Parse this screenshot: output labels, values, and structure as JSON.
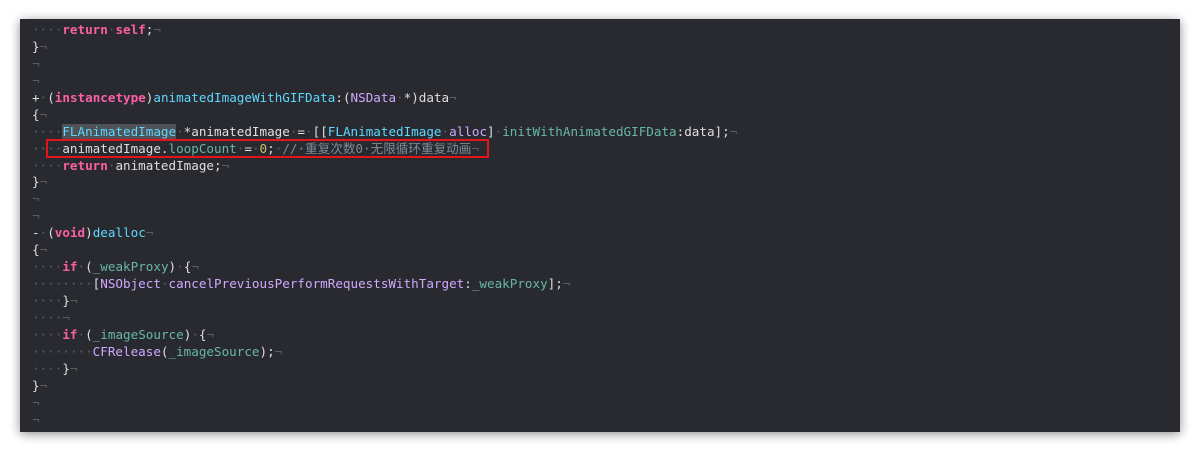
{
  "code_lines": [
    [
      {
        "t": "····",
        "k": "inv"
      },
      {
        "t": "return",
        "k": "kw"
      },
      {
        "t": "·",
        "k": "inv"
      },
      {
        "t": "self",
        "k": "kw"
      },
      {
        "t": ";",
        "k": "plain"
      },
      {
        "t": "¬",
        "k": "inv"
      }
    ],
    [
      {
        "t": "}",
        "k": "plain"
      },
      {
        "t": "¬",
        "k": "inv"
      }
    ],
    [
      {
        "t": "¬",
        "k": "inv"
      }
    ],
    [
      {
        "t": "¬",
        "k": "inv"
      }
    ],
    [
      {
        "t": "+",
        "k": "plain"
      },
      {
        "t": "·",
        "k": "inv"
      },
      {
        "t": "(",
        "k": "plain"
      },
      {
        "t": "instancetype",
        "k": "kw"
      },
      {
        "t": ")",
        "k": "plain"
      },
      {
        "t": "animatedImageWithGIFData",
        "k": "type"
      },
      {
        "t": ":(",
        "k": "plain"
      },
      {
        "t": "NSData",
        "k": "cls"
      },
      {
        "t": "·",
        "k": "inv"
      },
      {
        "t": "*)data",
        "k": "plain"
      },
      {
        "t": "¬",
        "k": "inv"
      }
    ],
    [
      {
        "t": "{",
        "k": "plain"
      },
      {
        "t": "¬",
        "k": "inv"
      }
    ],
    [
      {
        "t": "····",
        "k": "inv"
      },
      {
        "t": "FLAnimatedImage",
        "k": "type",
        "hl": true
      },
      {
        "t": "·",
        "k": "inv"
      },
      {
        "t": "*animatedImage",
        "k": "plain"
      },
      {
        "t": "·",
        "k": "inv"
      },
      {
        "t": "=",
        "k": "plain"
      },
      {
        "t": "·",
        "k": "inv"
      },
      {
        "t": "[[",
        "k": "plain"
      },
      {
        "t": "FLAnimatedImage",
        "k": "type"
      },
      {
        "t": "·",
        "k": "inv"
      },
      {
        "t": "alloc",
        "k": "cls"
      },
      {
        "t": "]",
        "k": "plain"
      },
      {
        "t": "·",
        "k": "inv"
      },
      {
        "t": "initWithAnimatedGIFData",
        "k": "meth"
      },
      {
        "t": ":data];",
        "k": "plain"
      },
      {
        "t": "¬",
        "k": "inv"
      }
    ],
    [
      {
        "t": "····",
        "k": "inv"
      },
      {
        "t": "animatedImage.",
        "k": "plain"
      },
      {
        "t": "loopCount",
        "k": "prop"
      },
      {
        "t": "·",
        "k": "inv"
      },
      {
        "t": "=",
        "k": "plain"
      },
      {
        "t": "·",
        "k": "inv"
      },
      {
        "t": "0",
        "k": "num"
      },
      {
        "t": ";",
        "k": "plain"
      },
      {
        "t": "·",
        "k": "inv"
      },
      {
        "t": "//·重复次数0·无限循环重复动画",
        "k": "comment"
      },
      {
        "t": "¬",
        "k": "inv"
      }
    ],
    [
      {
        "t": "····",
        "k": "inv"
      },
      {
        "t": "return",
        "k": "kw"
      },
      {
        "t": "·",
        "k": "inv"
      },
      {
        "t": "animatedImage;",
        "k": "plain"
      },
      {
        "t": "¬",
        "k": "inv"
      }
    ],
    [
      {
        "t": "}",
        "k": "plain"
      },
      {
        "t": "¬",
        "k": "inv"
      }
    ],
    [
      {
        "t": "¬",
        "k": "inv"
      }
    ],
    [
      {
        "t": "¬",
        "k": "inv"
      }
    ],
    [
      {
        "t": "-",
        "k": "plain"
      },
      {
        "t": "·",
        "k": "inv"
      },
      {
        "t": "(",
        "k": "plain"
      },
      {
        "t": "void",
        "k": "kw"
      },
      {
        "t": ")",
        "k": "plain"
      },
      {
        "t": "dealloc",
        "k": "type"
      },
      {
        "t": "¬",
        "k": "inv"
      }
    ],
    [
      {
        "t": "{",
        "k": "plain"
      },
      {
        "t": "¬",
        "k": "inv"
      }
    ],
    [
      {
        "t": "····",
        "k": "inv"
      },
      {
        "t": "if",
        "k": "kw"
      },
      {
        "t": "·",
        "k": "inv"
      },
      {
        "t": "(",
        "k": "plain"
      },
      {
        "t": "_weakProxy",
        "k": "prop"
      },
      {
        "t": ")",
        "k": "plain"
      },
      {
        "t": "·",
        "k": "inv"
      },
      {
        "t": "{",
        "k": "plain"
      },
      {
        "t": "¬",
        "k": "inv"
      }
    ],
    [
      {
        "t": "········",
        "k": "inv"
      },
      {
        "t": "[",
        "k": "plain"
      },
      {
        "t": "NSObject",
        "k": "cls"
      },
      {
        "t": "·",
        "k": "inv"
      },
      {
        "t": "cancelPreviousPerformRequestsWithTarget",
        "k": "cls"
      },
      {
        "t": ":",
        "k": "plain"
      },
      {
        "t": "_weakProxy",
        "k": "prop"
      },
      {
        "t": "];",
        "k": "plain"
      },
      {
        "t": "¬",
        "k": "inv"
      }
    ],
    [
      {
        "t": "····",
        "k": "inv"
      },
      {
        "t": "}",
        "k": "plain"
      },
      {
        "t": "¬",
        "k": "inv"
      }
    ],
    [
      {
        "t": "····¬",
        "k": "inv"
      }
    ],
    [
      {
        "t": "····",
        "k": "inv"
      },
      {
        "t": "if",
        "k": "kw"
      },
      {
        "t": "·",
        "k": "inv"
      },
      {
        "t": "(",
        "k": "plain"
      },
      {
        "t": "_imageSource",
        "k": "prop"
      },
      {
        "t": ")",
        "k": "plain"
      },
      {
        "t": "·",
        "k": "inv"
      },
      {
        "t": "{",
        "k": "plain"
      },
      {
        "t": "¬",
        "k": "inv"
      }
    ],
    [
      {
        "t": "········",
        "k": "inv"
      },
      {
        "t": "CFRelease",
        "k": "cls"
      },
      {
        "t": "(",
        "k": "plain"
      },
      {
        "t": "_imageSource",
        "k": "prop"
      },
      {
        "t": ");",
        "k": "plain"
      },
      {
        "t": "¬",
        "k": "inv"
      }
    ],
    [
      {
        "t": "····",
        "k": "inv"
      },
      {
        "t": "}",
        "k": "plain"
      },
      {
        "t": "¬",
        "k": "inv"
      }
    ],
    [
      {
        "t": "}",
        "k": "plain"
      },
      {
        "t": "¬",
        "k": "inv"
      }
    ],
    [
      {
        "t": "¬",
        "k": "inv"
      }
    ],
    [
      {
        "t": "¬",
        "k": "inv"
      }
    ]
  ],
  "highlight": {
    "line_index": 7,
    "color": "#e3151a"
  },
  "colors": {
    "background": "#292a30",
    "keyword": "#fc5fa3",
    "class": "#d0a8ff",
    "type": "#5dd8ff",
    "method": "#67b7a4",
    "number": "#d0bf69",
    "comment": "#7f8c98",
    "plain": "#dfdfe0",
    "invisibles": "#5a5d63"
  }
}
